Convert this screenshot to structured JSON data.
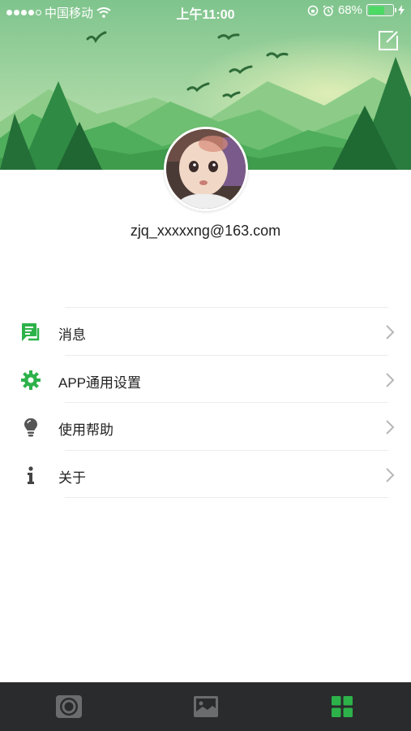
{
  "status_bar": {
    "carrier": "中国移动",
    "time": "上午11:00",
    "battery": "68%",
    "battery_level": 0.68
  },
  "profile": {
    "email": "zjq_xxxxxng@163.com"
  },
  "menu": {
    "items": [
      {
        "label": "消息",
        "icon": "message-icon"
      },
      {
        "label": "APP通用设置",
        "icon": "gear-icon"
      },
      {
        "label": "使用帮助",
        "icon": "lightbulb-icon"
      },
      {
        "label": "关于",
        "icon": "info-icon"
      }
    ]
  },
  "tabs": [
    {
      "name": "camera-tab",
      "icon": "camera-lens-icon",
      "active": false
    },
    {
      "name": "gallery-tab",
      "icon": "picture-icon",
      "active": false
    },
    {
      "name": "more-tab",
      "icon": "grid-icon",
      "active": true
    }
  ],
  "colors": {
    "accent": "#2db24a",
    "tab_bar_bg": "#2a2b2d",
    "tab_inactive": "#6b6c6e"
  }
}
